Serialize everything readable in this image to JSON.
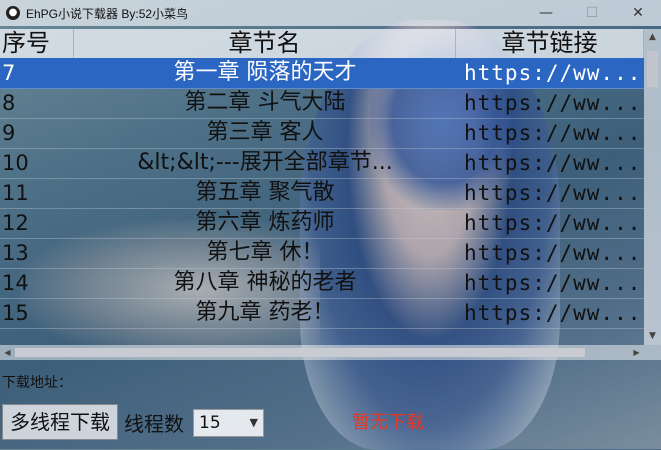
{
  "window": {
    "title": "EhPG小说下载器    By:52小菜鸟",
    "icon": "app-logo-icon",
    "buttons": {
      "minimize": "—",
      "maximize": "☐",
      "close": "✕"
    }
  },
  "table": {
    "columns": [
      "序号",
      "章节名",
      "章节链接"
    ],
    "rows": [
      {
        "index": "7",
        "name": "第一章 陨落的天才",
        "link": "https://ww...",
        "selected": true
      },
      {
        "index": "8",
        "name": "第二章 斗气大陆",
        "link": "https://ww..."
      },
      {
        "index": "9",
        "name": "第三章 客人",
        "link": "https://ww..."
      },
      {
        "index": "10",
        "name": "&lt;&lt;---展开全部章节...",
        "link": "https://ww..."
      },
      {
        "index": "11",
        "name": "第五章 聚气散",
        "link": "https://ww..."
      },
      {
        "index": "12",
        "name": "第六章 炼药师",
        "link": "https://ww..."
      },
      {
        "index": "13",
        "name": "第七章 休！",
        "link": "https://ww..."
      },
      {
        "index": "14",
        "name": "第八章 神秘的老者",
        "link": "https://ww..."
      },
      {
        "index": "15",
        "name": "第九章 药老！",
        "link": "https://ww..."
      }
    ],
    "selected_color": "#2b66c3"
  },
  "download": {
    "address_label": "下载地址：",
    "multi_button": "多线程下载",
    "thread_label": "线程数",
    "thread_value": "15",
    "status": "暂无下载",
    "status_color": "#e03a2a"
  }
}
